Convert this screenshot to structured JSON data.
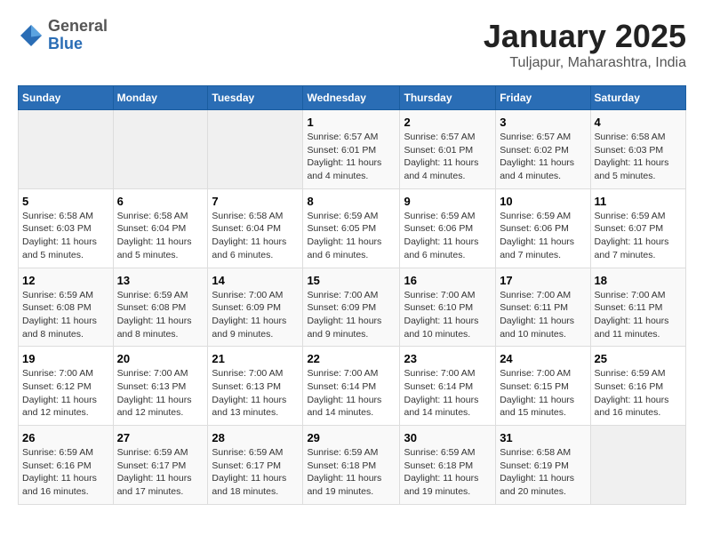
{
  "header": {
    "logo_general": "General",
    "logo_blue": "Blue",
    "title": "January 2025",
    "subtitle": "Tuljapur, Maharashtra, India"
  },
  "weekdays": [
    "Sunday",
    "Monday",
    "Tuesday",
    "Wednesday",
    "Thursday",
    "Friday",
    "Saturday"
  ],
  "weeks": [
    [
      {
        "day": "",
        "info": ""
      },
      {
        "day": "",
        "info": ""
      },
      {
        "day": "",
        "info": ""
      },
      {
        "day": "1",
        "info": "Sunrise: 6:57 AM\nSunset: 6:01 PM\nDaylight: 11 hours\nand 4 minutes."
      },
      {
        "day": "2",
        "info": "Sunrise: 6:57 AM\nSunset: 6:01 PM\nDaylight: 11 hours\nand 4 minutes."
      },
      {
        "day": "3",
        "info": "Sunrise: 6:57 AM\nSunset: 6:02 PM\nDaylight: 11 hours\nand 4 minutes."
      },
      {
        "day": "4",
        "info": "Sunrise: 6:58 AM\nSunset: 6:03 PM\nDaylight: 11 hours\nand 5 minutes."
      }
    ],
    [
      {
        "day": "5",
        "info": "Sunrise: 6:58 AM\nSunset: 6:03 PM\nDaylight: 11 hours\nand 5 minutes."
      },
      {
        "day": "6",
        "info": "Sunrise: 6:58 AM\nSunset: 6:04 PM\nDaylight: 11 hours\nand 5 minutes."
      },
      {
        "day": "7",
        "info": "Sunrise: 6:58 AM\nSunset: 6:04 PM\nDaylight: 11 hours\nand 6 minutes."
      },
      {
        "day": "8",
        "info": "Sunrise: 6:59 AM\nSunset: 6:05 PM\nDaylight: 11 hours\nand 6 minutes."
      },
      {
        "day": "9",
        "info": "Sunrise: 6:59 AM\nSunset: 6:06 PM\nDaylight: 11 hours\nand 6 minutes."
      },
      {
        "day": "10",
        "info": "Sunrise: 6:59 AM\nSunset: 6:06 PM\nDaylight: 11 hours\nand 7 minutes."
      },
      {
        "day": "11",
        "info": "Sunrise: 6:59 AM\nSunset: 6:07 PM\nDaylight: 11 hours\nand 7 minutes."
      }
    ],
    [
      {
        "day": "12",
        "info": "Sunrise: 6:59 AM\nSunset: 6:08 PM\nDaylight: 11 hours\nand 8 minutes."
      },
      {
        "day": "13",
        "info": "Sunrise: 6:59 AM\nSunset: 6:08 PM\nDaylight: 11 hours\nand 8 minutes."
      },
      {
        "day": "14",
        "info": "Sunrise: 7:00 AM\nSunset: 6:09 PM\nDaylight: 11 hours\nand 9 minutes."
      },
      {
        "day": "15",
        "info": "Sunrise: 7:00 AM\nSunset: 6:09 PM\nDaylight: 11 hours\nand 9 minutes."
      },
      {
        "day": "16",
        "info": "Sunrise: 7:00 AM\nSunset: 6:10 PM\nDaylight: 11 hours\nand 10 minutes."
      },
      {
        "day": "17",
        "info": "Sunrise: 7:00 AM\nSunset: 6:11 PM\nDaylight: 11 hours\nand 10 minutes."
      },
      {
        "day": "18",
        "info": "Sunrise: 7:00 AM\nSunset: 6:11 PM\nDaylight: 11 hours\nand 11 minutes."
      }
    ],
    [
      {
        "day": "19",
        "info": "Sunrise: 7:00 AM\nSunset: 6:12 PM\nDaylight: 11 hours\nand 12 minutes."
      },
      {
        "day": "20",
        "info": "Sunrise: 7:00 AM\nSunset: 6:13 PM\nDaylight: 11 hours\nand 12 minutes."
      },
      {
        "day": "21",
        "info": "Sunrise: 7:00 AM\nSunset: 6:13 PM\nDaylight: 11 hours\nand 13 minutes."
      },
      {
        "day": "22",
        "info": "Sunrise: 7:00 AM\nSunset: 6:14 PM\nDaylight: 11 hours\nand 14 minutes."
      },
      {
        "day": "23",
        "info": "Sunrise: 7:00 AM\nSunset: 6:14 PM\nDaylight: 11 hours\nand 14 minutes."
      },
      {
        "day": "24",
        "info": "Sunrise: 7:00 AM\nSunset: 6:15 PM\nDaylight: 11 hours\nand 15 minutes."
      },
      {
        "day": "25",
        "info": "Sunrise: 6:59 AM\nSunset: 6:16 PM\nDaylight: 11 hours\nand 16 minutes."
      }
    ],
    [
      {
        "day": "26",
        "info": "Sunrise: 6:59 AM\nSunset: 6:16 PM\nDaylight: 11 hours\nand 16 minutes."
      },
      {
        "day": "27",
        "info": "Sunrise: 6:59 AM\nSunset: 6:17 PM\nDaylight: 11 hours\nand 17 minutes."
      },
      {
        "day": "28",
        "info": "Sunrise: 6:59 AM\nSunset: 6:17 PM\nDaylight: 11 hours\nand 18 minutes."
      },
      {
        "day": "29",
        "info": "Sunrise: 6:59 AM\nSunset: 6:18 PM\nDaylight: 11 hours\nand 19 minutes."
      },
      {
        "day": "30",
        "info": "Sunrise: 6:59 AM\nSunset: 6:18 PM\nDaylight: 11 hours\nand 19 minutes."
      },
      {
        "day": "31",
        "info": "Sunrise: 6:58 AM\nSunset: 6:19 PM\nDaylight: 11 hours\nand 20 minutes."
      },
      {
        "day": "",
        "info": ""
      }
    ]
  ]
}
